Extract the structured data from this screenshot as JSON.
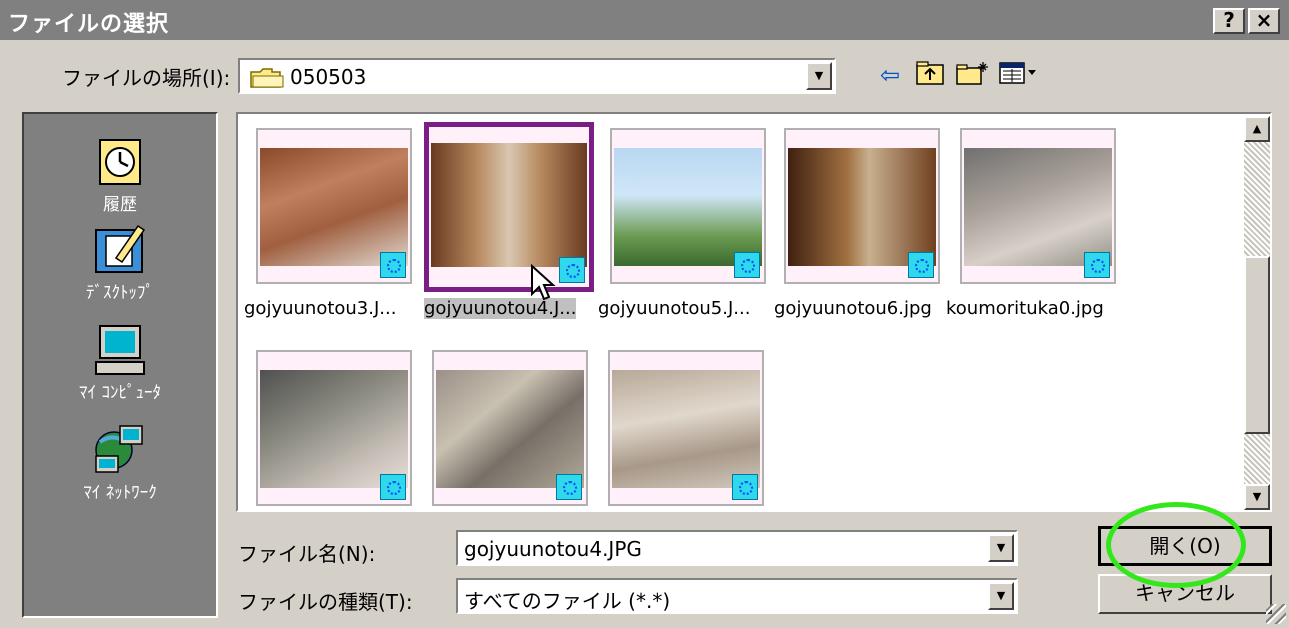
{
  "window": {
    "title": "ファイルの選択",
    "help_label": "?",
    "close_label": "×"
  },
  "location": {
    "label": "ファイルの場所(I):",
    "value": "050503"
  },
  "places": [
    {
      "label": "履歴"
    },
    {
      "label": "ﾃﾞｽｸﾄｯﾌﾟ"
    },
    {
      "label": "ﾏｲ ｺﾝﾋﾟｭｰﾀ"
    },
    {
      "label": "ﾏｲ ﾈｯﾄﾜｰｸ"
    }
  ],
  "files": [
    {
      "name": "gojyuunotou3.J..."
    },
    {
      "name": "gojyuunotou4.J..."
    },
    {
      "name": "gojyuunotou5.J..."
    },
    {
      "name": "gojyuunotou6.jpg"
    },
    {
      "name": "koumorituka0.jpg"
    }
  ],
  "filename": {
    "label": "ファイル名(N):",
    "value": "gojyuunotou4.JPG"
  },
  "filetype": {
    "label": "ファイルの種類(T):",
    "value": "すべてのファイル (*.*)"
  },
  "buttons": {
    "open": "開く(O)",
    "cancel": "キャンセル"
  },
  "colors": {
    "selection_border": "#7a1e86",
    "annotation_circle": "#33e81a",
    "places_bg": "#808080"
  }
}
